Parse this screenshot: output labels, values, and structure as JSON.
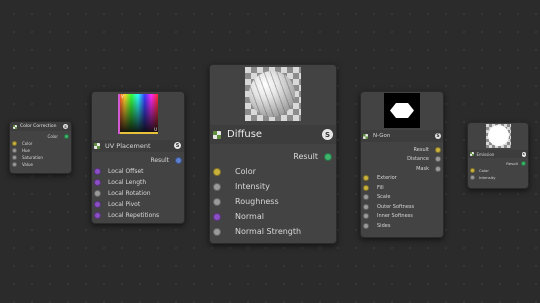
{
  "nodes": {
    "color_correction": {
      "title": "Color Correction",
      "outputs": [
        "Color"
      ],
      "inputs": [
        "Color",
        "Hue",
        "Saturation",
        "Value"
      ]
    },
    "uv_placement": {
      "title": "UV Placement",
      "thumb_axes": {
        "x": "U",
        "y": "V"
      },
      "outputs": [
        "Result"
      ],
      "inputs": [
        "Local Offset",
        "Local Length",
        "Local Rotation",
        "Local Pivot",
        "Local Repetitions"
      ]
    },
    "diffuse": {
      "title": "Diffuse",
      "outputs": [
        "Result"
      ],
      "inputs": [
        "Color",
        "Intensity",
        "Roughness",
        "Normal",
        "Normal Strength"
      ]
    },
    "n_gon": {
      "title": "N-Gon",
      "outputs": [
        "Result",
        "Distance",
        "Mask"
      ],
      "inputs": [
        "Exterior",
        "Fill",
        "Scale",
        "Outer Softness",
        "Inner Softness",
        "Sides"
      ]
    },
    "emission": {
      "title": "Emission",
      "outputs": [
        "Result"
      ],
      "inputs": [
        "Color",
        "Intensity"
      ]
    }
  },
  "badge_label": "S",
  "colors": {
    "canvas": "#2b2b2b",
    "node_body": "#434343",
    "port_yellow": "#c9b23c",
    "port_purple": "#8a4fc4",
    "port_gray": "#9a9a9a",
    "port_green": "#3db36b",
    "port_blue": "#5d7fd0"
  },
  "icons": {
    "node_header": "checker-node-icon",
    "node_badge": "s-badge-icon"
  }
}
